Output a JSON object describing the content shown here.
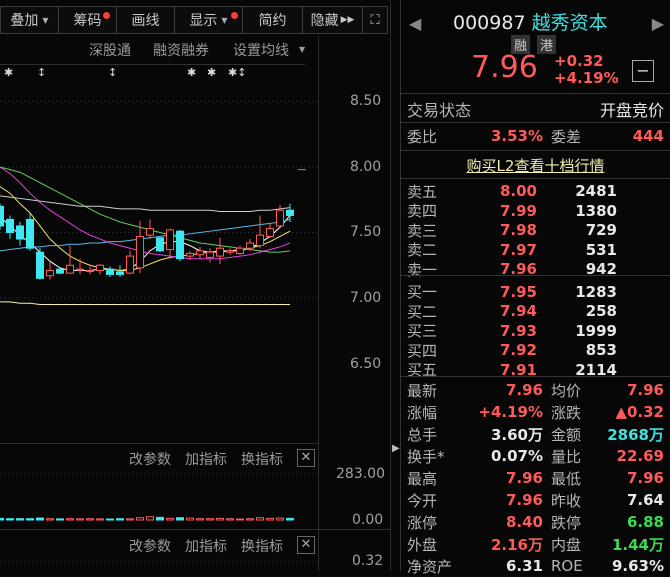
{
  "toolbar": {
    "items": [
      "叠加",
      "筹码",
      "画线",
      "显示",
      "简约",
      "隐藏"
    ],
    "fullscreen_icon": "expand-icon"
  },
  "subbar": {
    "links": [
      "深股通",
      "融资融券",
      "设置均线"
    ]
  },
  "price_axis": [
    "8.50",
    "8.00",
    "7.50",
    "7.00",
    "6.50"
  ],
  "indicator_buttons": [
    "改参数",
    "加指标",
    "换指标"
  ],
  "volume_axis": [
    "283.00",
    "0.00"
  ],
  "macd_axis": [
    "0.32"
  ],
  "stock": {
    "code": "000987",
    "name": "越秀资本",
    "tags": [
      "融",
      "港"
    ],
    "price": "7.96",
    "change": "+0.32",
    "change_pct": "+4.19%"
  },
  "status": {
    "label": "交易状态",
    "value": "开盘竞价"
  },
  "commission": {
    "ratio_label": "委比",
    "ratio": "3.53%",
    "diff_label": "委差",
    "diff": "444"
  },
  "l2_link": "购买L2查看十档行情",
  "asks": [
    {
      "label": "卖五",
      "price": "8.00",
      "vol": "2481"
    },
    {
      "label": "卖四",
      "price": "7.99",
      "vol": "1380"
    },
    {
      "label": "卖三",
      "price": "7.98",
      "vol": "729"
    },
    {
      "label": "卖二",
      "price": "7.97",
      "vol": "531"
    },
    {
      "label": "卖一",
      "price": "7.96",
      "vol": "942"
    }
  ],
  "bids": [
    {
      "label": "买一",
      "price": "7.95",
      "vol": "1283"
    },
    {
      "label": "买二",
      "price": "7.94",
      "vol": "258"
    },
    {
      "label": "买三",
      "price": "7.93",
      "vol": "1999"
    },
    {
      "label": "买四",
      "price": "7.92",
      "vol": "853"
    },
    {
      "label": "买五",
      "price": "7.91",
      "vol": "2114"
    }
  ],
  "quotes": [
    {
      "l1": "最新",
      "v1": "7.96",
      "c1": "red",
      "l2": "均价",
      "v2": "7.96",
      "c2": "red"
    },
    {
      "l1": "涨幅",
      "v1": "+4.19%",
      "c1": "red",
      "l2": "涨跌",
      "v2": "▲0.32",
      "c2": "red"
    },
    {
      "l1": "总手",
      "v1": "3.60万",
      "c1": "white",
      "l2": "金额",
      "v2": "2868万",
      "c2": "cyan"
    },
    {
      "l1": "换手*",
      "v1": "0.07%",
      "c1": "white",
      "l2": "量比",
      "v2": "22.69",
      "c2": "red"
    },
    {
      "l1": "最高",
      "v1": "7.96",
      "c1": "red",
      "l2": "最低",
      "v2": "7.96",
      "c2": "red"
    },
    {
      "l1": "今开",
      "v1": "7.96",
      "c1": "red",
      "l2": "昨收",
      "v2": "7.64",
      "c2": "white"
    },
    {
      "l1": "涨停",
      "v1": "8.40",
      "c1": "red",
      "l2": "跌停",
      "v2": "6.88",
      "c2": "green"
    },
    {
      "l1": "外盘",
      "v1": "2.16万",
      "c1": "red",
      "l2": "内盘",
      "v2": "1.44万",
      "c2": "green"
    },
    {
      "l1": "净资产",
      "v1": "6.31",
      "c1": "white",
      "l2": "ROE",
      "v2": "9.63%",
      "c2": "white"
    }
  ],
  "chart_data": {
    "type": "candlestick",
    "ylim": [
      6.5,
      8.5
    ],
    "ohlc": [
      [
        7.7,
        7.72,
        7.52,
        7.55
      ],
      [
        7.6,
        7.63,
        7.45,
        7.5
      ],
      [
        7.55,
        7.58,
        7.4,
        7.45
      ],
      [
        7.6,
        7.65,
        7.36,
        7.38
      ],
      [
        7.35,
        7.38,
        7.14,
        7.15
      ],
      [
        7.17,
        7.28,
        7.14,
        7.21
      ],
      [
        7.22,
        7.23,
        7.18,
        7.19
      ],
      [
        7.19,
        7.4,
        7.19,
        7.25
      ],
      [
        7.22,
        7.3,
        7.18,
        7.22
      ],
      [
        7.21,
        7.24,
        7.18,
        7.21
      ],
      [
        7.21,
        7.26,
        7.18,
        7.25
      ],
      [
        7.22,
        7.24,
        7.16,
        7.18
      ],
      [
        7.2,
        7.25,
        7.16,
        7.18
      ],
      [
        7.19,
        7.36,
        7.18,
        7.32
      ],
      [
        7.23,
        7.59,
        7.19,
        7.47
      ],
      [
        7.48,
        7.6,
        7.45,
        7.53
      ],
      [
        7.46,
        7.46,
        7.35,
        7.36
      ],
      [
        7.37,
        7.53,
        7.3,
        7.52
      ],
      [
        7.51,
        7.52,
        7.28,
        7.3
      ],
      [
        7.32,
        7.36,
        7.29,
        7.34
      ],
      [
        7.33,
        7.39,
        7.3,
        7.36
      ],
      [
        7.31,
        7.38,
        7.27,
        7.35
      ],
      [
        7.32,
        7.46,
        7.26,
        7.38
      ],
      [
        7.35,
        7.38,
        7.33,
        7.36
      ],
      [
        7.34,
        7.4,
        7.33,
        7.38
      ],
      [
        7.38,
        7.45,
        7.36,
        7.42
      ],
      [
        7.4,
        7.63,
        7.38,
        7.48
      ],
      [
        7.47,
        7.57,
        7.46,
        7.53
      ],
      [
        7.55,
        7.71,
        7.55,
        7.67
      ],
      [
        7.67,
        7.72,
        7.58,
        7.63
      ]
    ],
    "ma": [
      {
        "color": "#ffffff",
        "values": [
          7.62,
          7.55,
          7.48,
          7.42,
          7.35,
          7.28,
          7.23,
          7.21,
          7.21,
          7.21,
          7.22,
          7.22,
          7.21,
          7.22,
          7.28,
          7.36,
          7.41,
          7.43,
          7.43,
          7.4,
          7.36,
          7.35,
          7.36,
          7.36,
          7.36,
          7.38,
          7.42,
          7.47,
          7.54,
          7.63
        ]
      },
      {
        "color": "#f5e66a",
        "values": [
          7.85,
          7.8,
          7.72,
          7.65,
          7.55,
          7.45,
          7.38,
          7.32,
          7.28,
          7.25,
          7.23,
          7.22,
          7.21,
          7.21,
          7.23,
          7.26,
          7.29,
          7.31,
          7.32,
          7.33,
          7.34,
          7.35,
          7.35,
          7.36,
          7.37,
          7.38,
          7.4,
          7.43,
          7.47,
          7.51
        ]
      },
      {
        "color": "#e040e0",
        "values": [
          8.0,
          7.95,
          7.88,
          7.8,
          7.73,
          7.67,
          7.62,
          7.57,
          7.52,
          7.48,
          7.45,
          7.42,
          7.4,
          7.38,
          7.36,
          7.34,
          7.33,
          7.32,
          7.31,
          7.3,
          7.3,
          7.3,
          7.3,
          7.31,
          7.32,
          7.33,
          7.35,
          7.37,
          7.39,
          7.42
        ]
      },
      {
        "color": "#5fd05f",
        "values": [
          8.0,
          7.98,
          7.96,
          7.92,
          7.88,
          7.84,
          7.8,
          7.76,
          7.72,
          7.68,
          7.64,
          7.61,
          7.58,
          7.56,
          7.54,
          7.52,
          7.5,
          7.48,
          7.46,
          7.44,
          7.42,
          7.41,
          7.4,
          7.39,
          7.38,
          7.37,
          7.36,
          7.35,
          7.35,
          7.36
        ]
      },
      {
        "color": "#5ab8e8",
        "values": [
          7.36,
          7.37,
          7.38,
          7.39,
          7.39,
          7.4,
          7.4,
          7.41,
          7.41,
          7.42,
          7.42,
          7.43,
          7.43,
          7.44,
          7.45,
          7.46,
          7.47,
          7.48,
          7.48,
          7.49,
          7.5,
          7.51,
          7.52,
          7.53,
          7.54,
          7.55,
          7.56,
          7.57,
          7.58,
          7.6
        ]
      },
      {
        "color": "#cfcfcf",
        "values": [
          7.78,
          7.77,
          7.76,
          7.75,
          7.74,
          7.73,
          7.72,
          7.71,
          7.7,
          7.7,
          7.7,
          7.69,
          7.68,
          7.68,
          7.68,
          7.67,
          7.67,
          7.67,
          7.67,
          7.67,
          7.67,
          7.67,
          7.66,
          7.66,
          7.66,
          7.66,
          7.67,
          7.67,
          7.68,
          7.69
        ]
      },
      {
        "color": "#f3f0b0",
        "values": [
          6.97,
          6.97,
          6.96,
          6.96,
          6.95,
          6.95,
          6.95,
          6.95,
          6.95,
          6.95,
          6.95,
          6.95,
          6.95,
          6.95,
          6.95,
          6.95,
          6.95,
          6.95,
          6.95,
          6.95,
          6.95,
          6.95,
          6.95,
          6.95,
          6.95,
          6.95,
          6.95,
          6.95,
          6.95,
          6.95
        ]
      }
    ],
    "volume": [
      10,
      8,
      8,
      8,
      12,
      8,
      7,
      8,
      7,
      8,
      7,
      6,
      8,
      7,
      14,
      20,
      16,
      10,
      14,
      12,
      8,
      8,
      10,
      8,
      6,
      8,
      14,
      10,
      12,
      10
    ],
    "ylim_volume": [
      0,
      283
    ]
  }
}
